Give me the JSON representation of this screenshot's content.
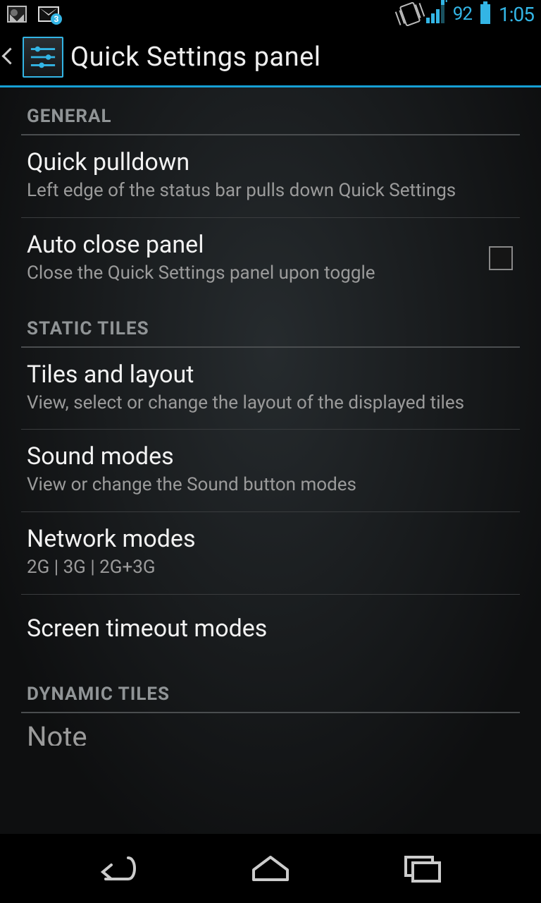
{
  "status": {
    "gmail_badge": "3",
    "battery_pct": "92",
    "clock": "1:05"
  },
  "actionbar": {
    "title": "Quick Settings panel"
  },
  "sections": [
    {
      "header": "GENERAL",
      "items": [
        {
          "title": "Quick pulldown",
          "sub": "Left edge of the status bar pulls down Quick Settings",
          "checkbox": false
        },
        {
          "title": "Auto close panel",
          "sub": "Close the Quick Settings panel upon toggle",
          "checkbox": true
        }
      ]
    },
    {
      "header": "STATIC TILES",
      "items": [
        {
          "title": "Tiles and layout",
          "sub": "View, select or change the layout of the displayed tiles"
        },
        {
          "title": "Sound modes",
          "sub": "View or change the Sound button modes"
        },
        {
          "title": "Network modes",
          "sub": "2G | 3G | 2G+3G"
        },
        {
          "title": "Screen timeout modes",
          "sub": ""
        }
      ]
    },
    {
      "header": "DYNAMIC TILES",
      "items": [
        {
          "title": "Note",
          "sub": "",
          "cutoff": true
        }
      ]
    }
  ]
}
